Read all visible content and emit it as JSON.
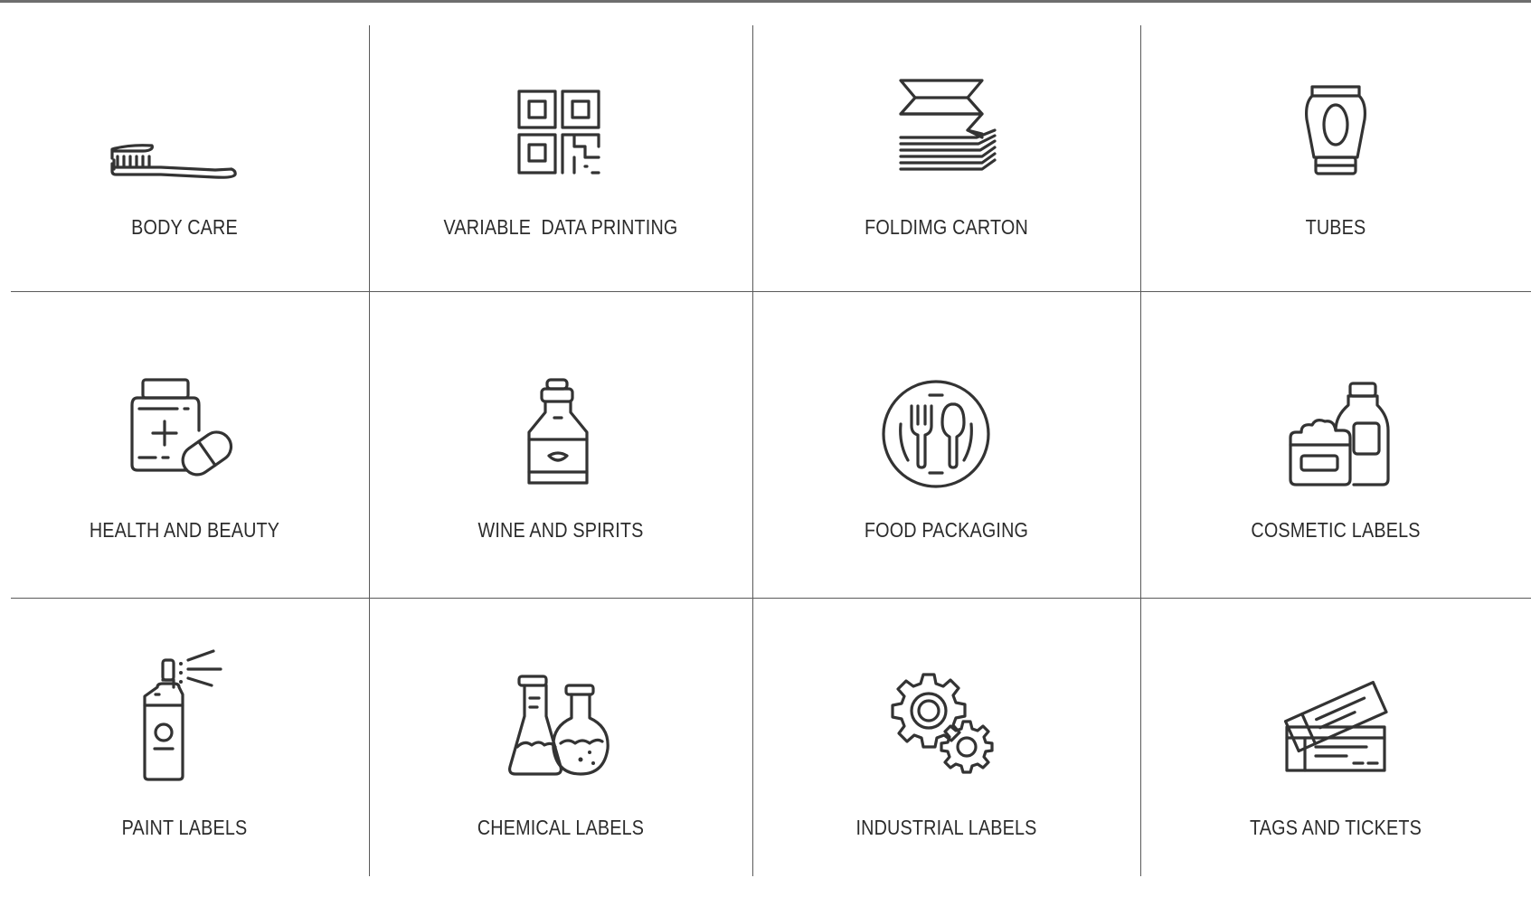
{
  "colors": {
    "line": "#5a5a5a",
    "icon": "#333333",
    "text": "#2b2b2b",
    "background": "#ffffff"
  },
  "categories": [
    {
      "label": "BODY CARE",
      "icon": "toothbrush-icon"
    },
    {
      "label": "VARIABLE  DATA PRINTING",
      "icon": "qr-code-icon"
    },
    {
      "label": "FOLDIMG CARTON",
      "icon": "folding-carton-icon"
    },
    {
      "label": "TUBES",
      "icon": "tube-icon"
    },
    {
      "label": "HEALTH AND BEAUTY",
      "icon": "medicine-bottle-icon"
    },
    {
      "label": "WINE AND SPIRITS",
      "icon": "bottle-icon"
    },
    {
      "label": "FOOD PACKAGING",
      "icon": "plate-cutlery-icon"
    },
    {
      "label": "COSMETIC LABELS",
      "icon": "cosmetic-jar-icon"
    },
    {
      "label": "PAINT LABELS",
      "icon": "spray-can-icon"
    },
    {
      "label": "CHEMICAL LABELS",
      "icon": "chemical-flask-icon"
    },
    {
      "label": "INDUSTRIAL LABELS",
      "icon": "gears-icon"
    },
    {
      "label": "TAGS AND TICKETS",
      "icon": "tickets-icon"
    }
  ]
}
